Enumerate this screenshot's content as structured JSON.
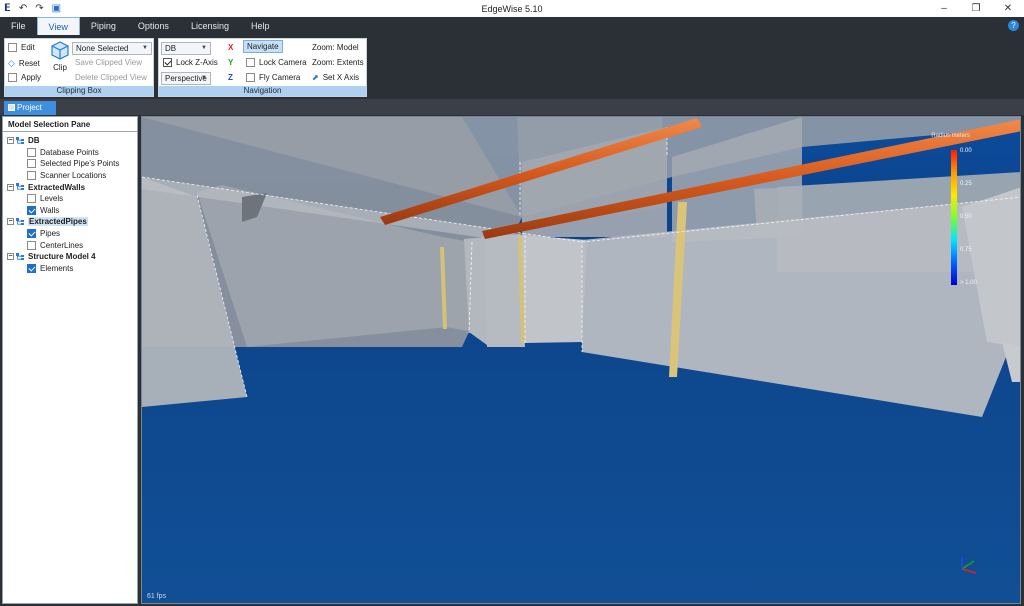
{
  "window": {
    "title": "EdgeWise 5.10"
  },
  "menu": [
    "File",
    "View",
    "Piping",
    "Options",
    "Licensing",
    "Help"
  ],
  "ribbon": {
    "clipping": {
      "edit": "Edit",
      "reset": "Reset",
      "apply": "Apply",
      "clip": "Clip",
      "selection": "None Selected",
      "save_clipped": "Save Clipped View",
      "delete_clipped": "Delete Clipped View",
      "label": "Clipping Box"
    },
    "navigation": {
      "db": "DB",
      "lock_z": "Lock Z-Axis",
      "projection": "Perspective",
      "x": "X",
      "y": "Y",
      "z": "Z",
      "navigate": "Navigate",
      "lock_camera": "Lock Camera",
      "fly_camera": "Fly Camera",
      "zoom_model": "Zoom: Model",
      "zoom_extents": "Zoom: Extents",
      "set_x_axis": "Set X Axis",
      "label": "Navigation"
    }
  },
  "tab": {
    "label": "Project"
  },
  "pane": {
    "title": "Model Selection Pane",
    "tree": [
      {
        "label": "DB",
        "children": [
          {
            "label": "Database Points",
            "checked": false
          },
          {
            "label": "Selected Pipe's Points",
            "checked": false
          },
          {
            "label": "Scanner Locations",
            "checked": false
          }
        ]
      },
      {
        "label": "ExtractedWalls",
        "children": [
          {
            "label": "Levels",
            "checked": false
          },
          {
            "label": "Walls",
            "checked": true
          }
        ]
      },
      {
        "label": "ExtractedPipes",
        "children": [
          {
            "label": "Pipes",
            "checked": true
          },
          {
            "label": "CenterLines",
            "checked": false
          }
        ]
      },
      {
        "label": "Structure Model 4",
        "children": [
          {
            "label": "Elements",
            "checked": true
          }
        ]
      }
    ]
  },
  "viewport": {
    "fps": "61 fps",
    "legend": {
      "title": "Radius meters",
      "labels": [
        "0.00",
        "0.25",
        "0.50",
        "0.75",
        "> 1.00"
      ]
    }
  }
}
